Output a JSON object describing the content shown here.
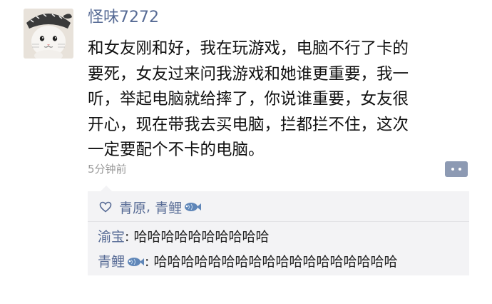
{
  "post": {
    "username": "怪味7272",
    "text_lines": [
      "和女友刚和好，我在玩游戏，电脑不行了卡的",
      "要死，女友过来问我游戏和她谁更重要，我一",
      "听，举起电脑就给摔了，你说谁重要，女友很",
      "开心，现在带我去买电脑，拦都拦不住，这次",
      "一定要配个不卡的电脑。"
    ],
    "timestamp": "5分钟前"
  },
  "likes": {
    "names": [
      "青原",
      "青鲤"
    ],
    "separator": ", ",
    "icon": "heart-outline-icon"
  },
  "comments": [
    {
      "author": "渝宝",
      "separator": ": ",
      "text": "哈哈哈哈哈哈哈哈哈哈",
      "author_icon": null
    },
    {
      "author": "青鲤",
      "separator": ": ",
      "text": "哈哈哈哈哈哈哈哈哈哈哈哈哈哈哈哈哈哈",
      "author_icon": "fish-emoji-icon"
    }
  ],
  "colors": {
    "link": "#576b95",
    "timestamp": "#9a9a9a",
    "comment_bg": "#f3f3f5",
    "comment_button": "#8d9ab3"
  }
}
